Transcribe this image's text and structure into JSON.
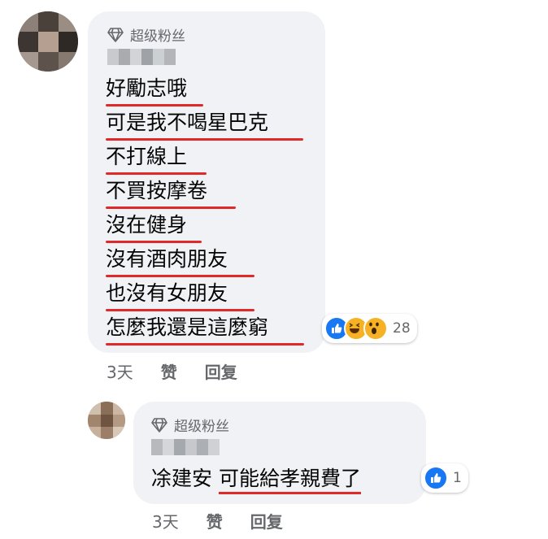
{
  "comment1": {
    "badge": "超级粉丝",
    "lines": [
      "好勵志哦",
      "可是我不喝星巴克",
      "不打線上",
      "不買按摩卷",
      "沒在健身",
      "沒有酒肉朋友",
      "也沒有女朋友",
      "怎麼我還是這麼窮"
    ],
    "reaction_count": "28",
    "reactions": [
      "like-icon",
      "haha-icon",
      "wow-icon"
    ],
    "time": "3天",
    "like_label": "赞",
    "reply_label": "回复"
  },
  "comment2": {
    "badge": "超级粉丝",
    "text_plain": "凃建安 ",
    "text_underlined": "可能給孝親費了",
    "reaction_count": "1",
    "reactions": [
      "like-icon"
    ],
    "time": "3天",
    "like_label": "赞",
    "reply_label": "回复"
  },
  "colors": {
    "underline": "#e02a2a",
    "bubble": "#f0f2f5",
    "like": "#1877f2",
    "emoji": "#f7b125",
    "meta": "#65676b"
  }
}
